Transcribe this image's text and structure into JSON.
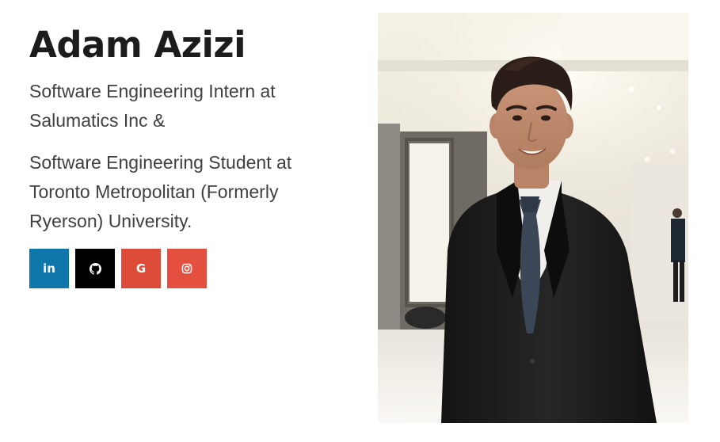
{
  "profile": {
    "name": "Adam Azizi",
    "bio_line_1": "Software Engineering Intern at Salumatics Inc &",
    "bio_line_2": "Software Engineering Student at Toronto Metropolitan (Formerly Ryerson) University."
  },
  "social": {
    "linkedin_glyph": "in",
    "google_glyph": "G",
    "buttons": [
      {
        "icon": "linkedin-icon",
        "color": "#0e76a8"
      },
      {
        "icon": "github-icon",
        "color": "#000000"
      },
      {
        "icon": "google-icon",
        "color": "#dd4b39"
      },
      {
        "icon": "instagram-icon",
        "color": "#e4503f"
      }
    ]
  },
  "photo": {
    "subject": "portrait-photo"
  }
}
